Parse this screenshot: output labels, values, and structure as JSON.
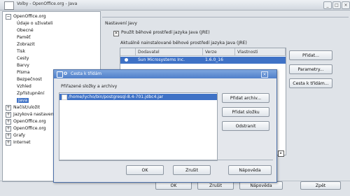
{
  "window": {
    "title": "Volby - OpenOffice.org - Java"
  },
  "tree": {
    "items": [
      {
        "label": "OpenOffice.org",
        "expander": "−"
      },
      {
        "label": "Údaje o uživateli"
      },
      {
        "label": "Obecné"
      },
      {
        "label": "Paměť"
      },
      {
        "label": "Zobrazit"
      },
      {
        "label": "Tisk"
      },
      {
        "label": "Cesty"
      },
      {
        "label": "Barvy"
      },
      {
        "label": "Písma"
      },
      {
        "label": "Bezpečnost"
      },
      {
        "label": "Vzhled"
      },
      {
        "label": "Zpřístupnění"
      },
      {
        "label": "Java"
      },
      {
        "label": "Načíst/uložit",
        "expander": "+"
      },
      {
        "label": "Jazyková nastavení",
        "expander": "+"
      },
      {
        "label": "OpenOffice.org",
        "expander": "+"
      },
      {
        "label": "OpenOffice.org",
        "expander": "+"
      },
      {
        "label": "Grafy",
        "expander": "+"
      },
      {
        "label": "Internet",
        "expander": "+"
      }
    ]
  },
  "options": {
    "group_title": "Nastavení Javy",
    "use_jre_label": "Použít běhové prostředí jazyka Java (JRE)",
    "installed_label": "Aktuálně nainstalované běhové prostředí jazyka Java (JRE)",
    "table_headers": [
      "Dodavatel",
      "Verze",
      "Vlastnosti"
    ],
    "rows": [
      {
        "vendor": "Sun Microsystems Inc.",
        "version": "1.6.0_16"
      }
    ],
    "buttons": {
      "add": "Přidat...",
      "parameters": "Parametry...",
      "classpath": "Cesta k třídám..."
    }
  },
  "main_buttons": {
    "ok": "OK",
    "cancel": "Zrušit",
    "help": "Nápověda",
    "back": "Zpět"
  },
  "dialog": {
    "title": "Cesta k třídám",
    "list_label": "Přiřazené složky a archivy",
    "items": [
      "/home/lycho/bin/postgresql-8.4-701.jdbc4.jar"
    ],
    "buttons": {
      "add_archive": "Přidat archiv...",
      "add_folder": "Přidat složku",
      "remove": "Odstranit"
    },
    "footer_buttons": {
      "ok": "OK",
      "cancel": "Zrušit",
      "help": "Nápověda"
    }
  },
  "colors": {
    "selection": "#3f72c6",
    "dialog_title": "#4f7fc9"
  }
}
